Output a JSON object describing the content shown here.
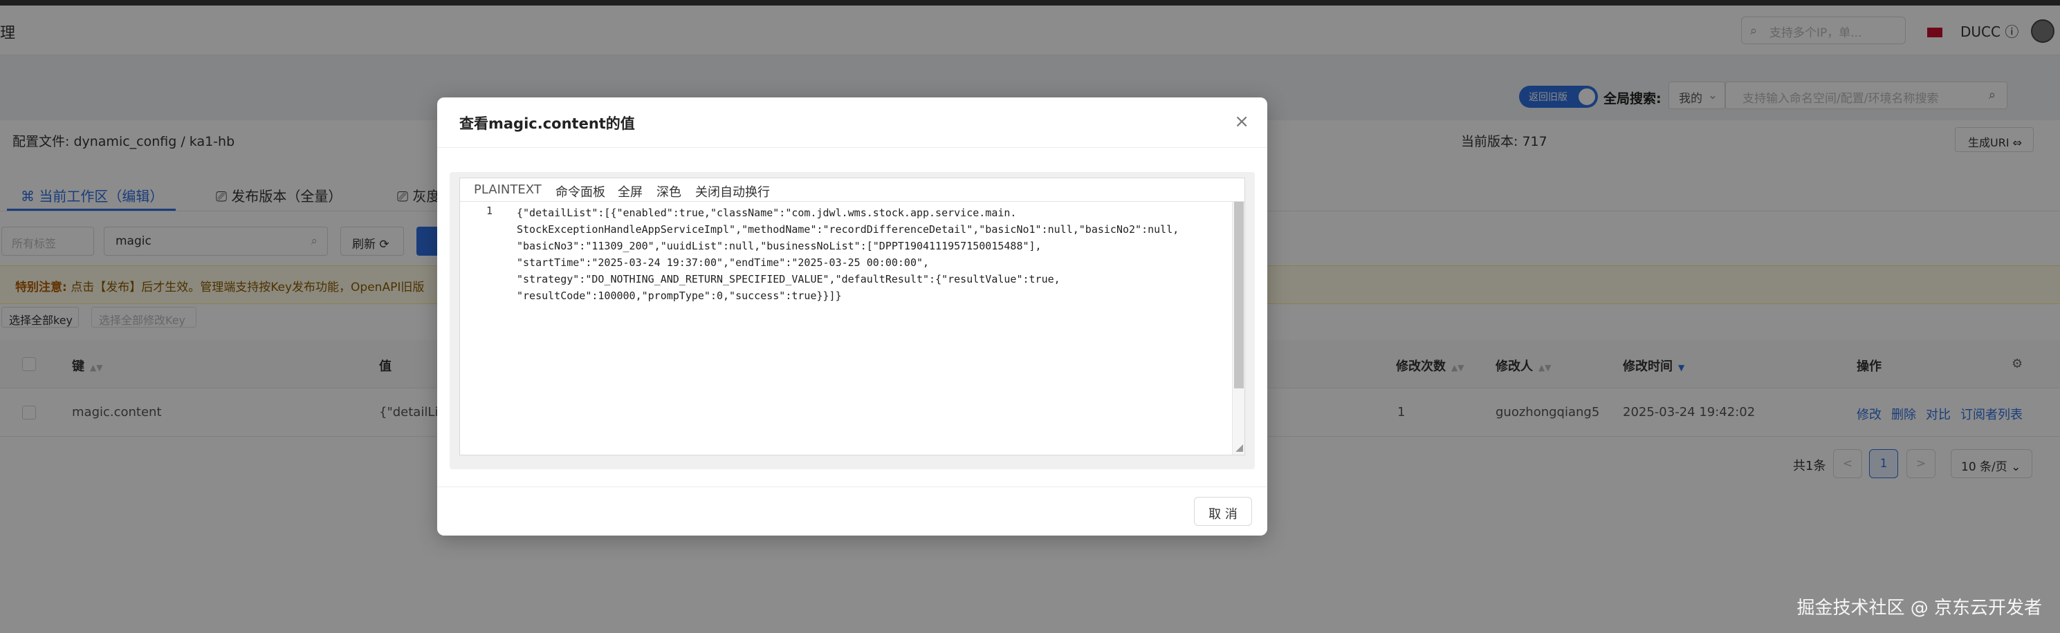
{
  "header": {
    "app_title": "理",
    "ip_search_placeholder": "支持多个IP，单...",
    "ducc_label": "DUCC ⓘ"
  },
  "filterbar": {
    "toggle_label": "返回旧版",
    "global_search_label": "全局搜索:",
    "scope_value": "我的",
    "global_search_placeholder": "支持输入命名空间/配置/环境名称搜索"
  },
  "config": {
    "file_label": "配置文件: dynamic_config / ka1-hb",
    "version_label": "当前版本: 717",
    "gen_url_label": "生成URI ⇔"
  },
  "tabs": [
    {
      "label": "⌘  当前工作区（编辑）",
      "active": true
    },
    {
      "label": "⎚  发布版本（全量）"
    },
    {
      "label": "⎚  灰度"
    }
  ],
  "toolbar": {
    "tag_placeholder": "所有标签",
    "key_search_value": "magic",
    "refresh_label": "刷新 ⟳",
    "notice_title": "特别注意:",
    "notice_text": "点击【发布】后才生效。管理端支持按Key发布功能，OpenAPI旧版",
    "select_all_label": "选择全部key",
    "select_modified_label": "选择全部修改Key"
  },
  "table": {
    "columns": [
      "键",
      "值",
      "修改次数",
      "修改人",
      "修改时间",
      "操作"
    ],
    "rows": [
      {
        "key": "magic.content",
        "value": "{\"detailList",
        "modify_count": "1",
        "modifier": "guozhongqiang5",
        "modify_time": "2025-03-24 19:42:02",
        "actions": [
          "修改",
          "删除",
          "对比",
          "订阅者列表"
        ]
      }
    ]
  },
  "pager": {
    "total_label": "共1条",
    "prev": "<",
    "current_page": "1",
    "next": ">",
    "page_size": "10 条/页 ⌄"
  },
  "modal": {
    "title": "查看magic.content的值",
    "close": "×",
    "editor_toolbar": [
      "PLAINTEXT",
      "命令面板",
      "全屏",
      "深色",
      "关闭自动换行"
    ],
    "line_number": "1",
    "code": "{\"detailList\":[{\"enabled\":true,\"className\":\"com.jdwl.wms.stock.app.service.main.\nStockExceptionHandleAppServiceImpl\",\"methodName\":\"recordDifferenceDetail\",\"basicNo1\":null,\"basicNo2\":null,\n\"basicNo3\":\"11309_200\",\"uuidList\":null,\"businessNoList\":[\"DPPT190411195715001548​8\"],\n\"startTime\":\"2025-03-24 19:37:00\",\"endTime\":\"2025-03-25 00:00:00\",\n\"strategy\":\"DO_NOTHING_AND_RETURN_SPECIFIED_VALUE\",\"defaultResult\":{\"resultValue\":true,\n\"resultCode\":100000,\"prompType\":0,\"success\":true}}]}",
    "cancel_label": "取 消"
  },
  "watermark": "掘金技术社区 @ 京东云开发者"
}
